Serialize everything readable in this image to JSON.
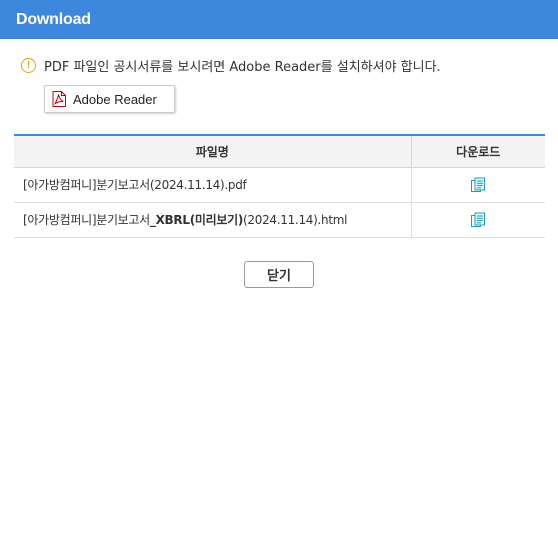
{
  "window": {
    "title": "Download"
  },
  "notice": {
    "icon": "warning-circle-icon",
    "text": "PDF 파일인 공시서류를 보시려면 Adobe Reader를 설치하셔야 합니다."
  },
  "adobe_button": {
    "label": "Adobe Reader",
    "icon": "pdf-icon"
  },
  "table": {
    "headers": {
      "name": "파일명",
      "download": "다운로드"
    },
    "rows": [
      {
        "prefix": "[아가방컴퍼니]분기보고서(2024.11.14).pdf",
        "bold": "",
        "suffix": ""
      },
      {
        "prefix": "[아가방컴퍼니]분기보고서",
        "bold": "_XBRL(미리보기)",
        "suffix": "(2024.11.14).html"
      }
    ]
  },
  "close_button": {
    "label": "닫기"
  },
  "colors": {
    "title_bar": "#3d87dd",
    "warning": "#e3a500",
    "download_icon": "#17a2b8"
  }
}
